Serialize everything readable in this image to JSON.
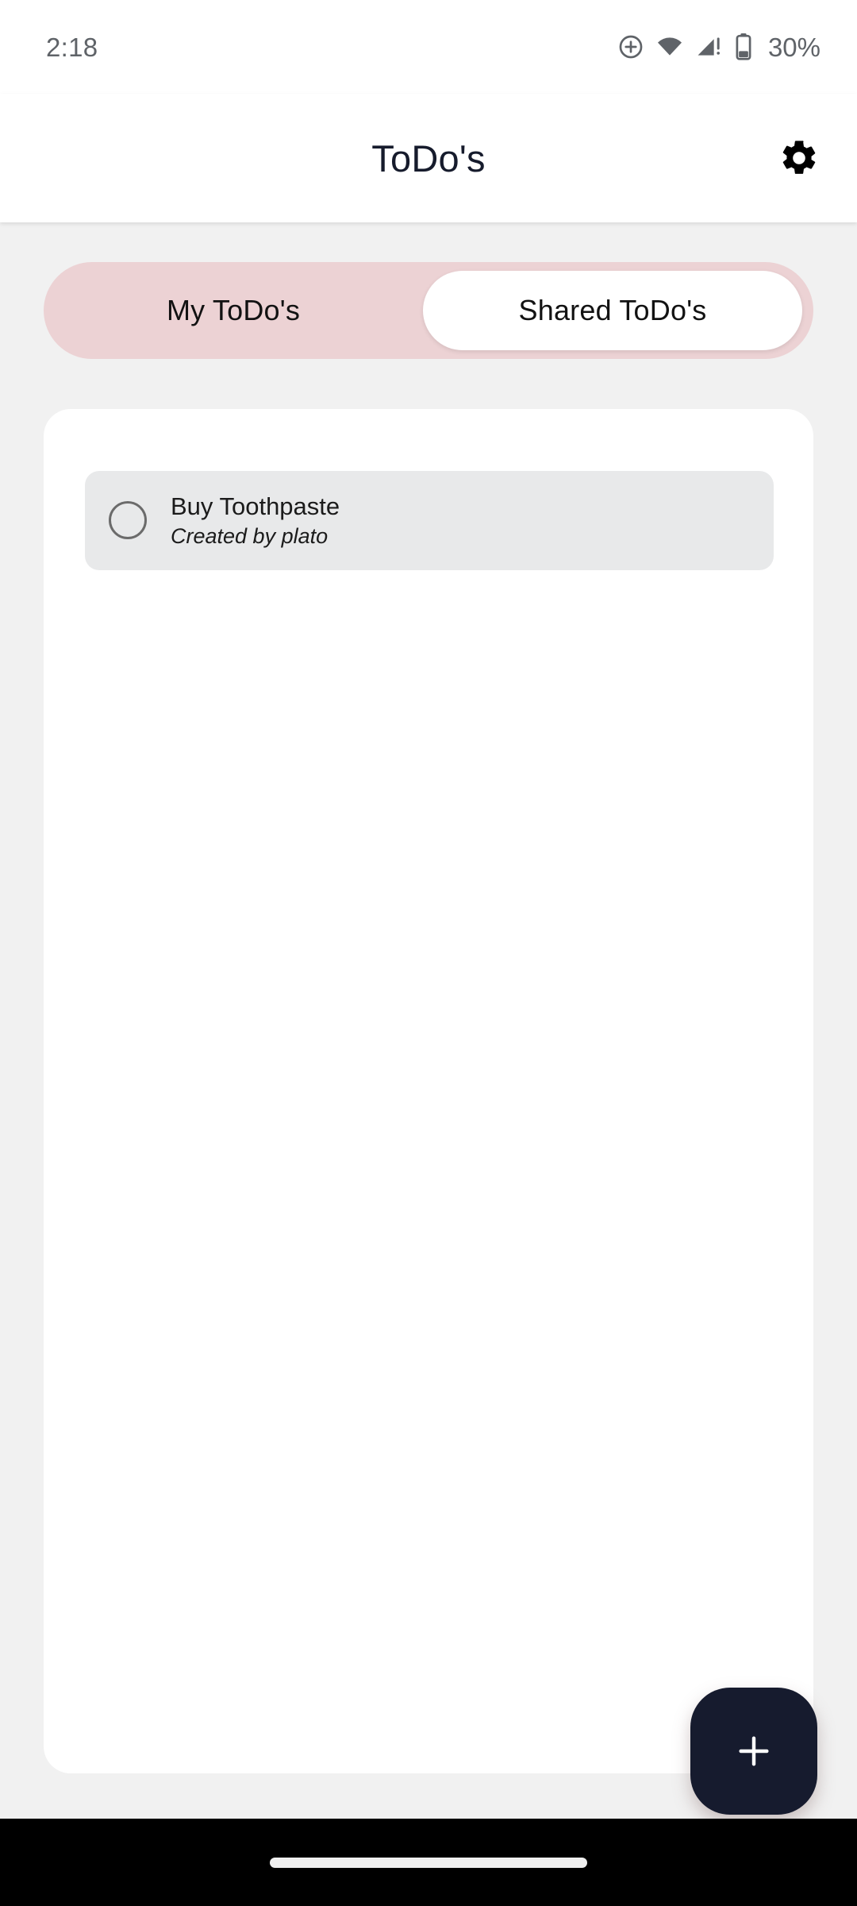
{
  "status_bar": {
    "time": "2:18",
    "battery_percent": "30%",
    "icons": [
      "data-saver-icon",
      "wifi-icon",
      "cellular-signal-warning-icon",
      "battery-icon"
    ]
  },
  "app_bar": {
    "title": "ToDo's",
    "settings_icon": "gear-icon"
  },
  "tabs": {
    "items": [
      {
        "label": "My ToDo's",
        "selected": false
      },
      {
        "label": "Shared ToDo's",
        "selected": true
      }
    ]
  },
  "todo_list": {
    "items": [
      {
        "title": "Buy Toothpaste",
        "subtitle": "Created by plato",
        "checked": false
      }
    ]
  },
  "fab": {
    "icon": "plus-icon",
    "label": "+"
  },
  "nav_bar": {
    "handle": "gesture-pill"
  },
  "colors": {
    "page_background": "#f1f1f1",
    "card_background": "#ffffff",
    "tab_track": "#ecd2d4",
    "tab_selected": "#ffffff",
    "todo_item_background": "#e8e9ea",
    "accent_dark": "#161b2e",
    "status_text": "#5f6368",
    "nav_bar": "#000000"
  }
}
